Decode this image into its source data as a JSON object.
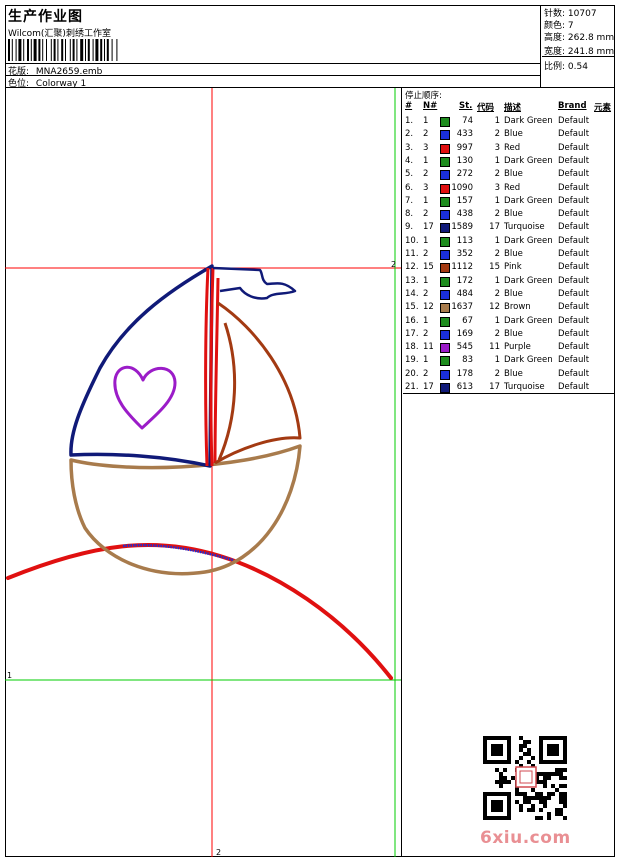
{
  "header": {
    "title": "生产作业图",
    "studio": "Wilcom(汇聚)刺绣工作室",
    "design_label": "花版:",
    "design_value": "MNA2659.emb",
    "colorway_label": "色位:",
    "colorway_value": "Colorway 1"
  },
  "stats": {
    "stitches_label": "针数:",
    "stitches_value": "10707",
    "colors_label": "颜色:",
    "colors_value": "7",
    "height_label": "高度:",
    "height_value": "262.8 mm",
    "width_label": "宽度:",
    "width_value": "241.8 mm",
    "scale_label": "比例:",
    "scale_value": "0.54"
  },
  "stop_panel": {
    "title": "停止顺序:",
    "headers": {
      "num": "#",
      "needle": "N#",
      "stitches": "St.",
      "code": "代码",
      "desc": "描述",
      "brand": "Brand",
      "element": "元素"
    },
    "rows": [
      {
        "num": "1.",
        "needle": "1",
        "st": "74",
        "code": "1",
        "desc": "Dark Green",
        "brand": "Default",
        "color": "#1e8c1e"
      },
      {
        "num": "2.",
        "needle": "2",
        "st": "433",
        "code": "2",
        "desc": "Blue",
        "brand": "Default",
        "color": "#1a2fd8"
      },
      {
        "num": "3.",
        "needle": "3",
        "st": "997",
        "code": "3",
        "desc": "Red",
        "brand": "Default",
        "color": "#e01010"
      },
      {
        "num": "4.",
        "needle": "1",
        "st": "130",
        "code": "1",
        "desc": "Dark Green",
        "brand": "Default",
        "color": "#1e8c1e"
      },
      {
        "num": "5.",
        "needle": "2",
        "st": "272",
        "code": "2",
        "desc": "Blue",
        "brand": "Default",
        "color": "#1a2fd8"
      },
      {
        "num": "6.",
        "needle": "3",
        "st": "1090",
        "code": "3",
        "desc": "Red",
        "brand": "Default",
        "color": "#e01010"
      },
      {
        "num": "7.",
        "needle": "1",
        "st": "157",
        "code": "1",
        "desc": "Dark Green",
        "brand": "Default",
        "color": "#1e8c1e"
      },
      {
        "num": "8.",
        "needle": "2",
        "st": "438",
        "code": "2",
        "desc": "Blue",
        "brand": "Default",
        "color": "#1a2fd8"
      },
      {
        "num": "9.",
        "needle": "17",
        "st": "1589",
        "code": "17",
        "desc": "Turquoise",
        "brand": "Default",
        "color": "#101a78"
      },
      {
        "num": "10.",
        "needle": "1",
        "st": "113",
        "code": "1",
        "desc": "Dark Green",
        "brand": "Default",
        "color": "#1e8c1e"
      },
      {
        "num": "11.",
        "needle": "2",
        "st": "352",
        "code": "2",
        "desc": "Blue",
        "brand": "Default",
        "color": "#1a2fd8"
      },
      {
        "num": "12.",
        "needle": "15",
        "st": "1112",
        "code": "15",
        "desc": "Pink",
        "brand": "Default",
        "color": "#a33a12"
      },
      {
        "num": "13.",
        "needle": "1",
        "st": "172",
        "code": "1",
        "desc": "Dark Green",
        "brand": "Default",
        "color": "#1e8c1e"
      },
      {
        "num": "14.",
        "needle": "2",
        "st": "484",
        "code": "2",
        "desc": "Blue",
        "brand": "Default",
        "color": "#1a2fd8"
      },
      {
        "num": "15.",
        "needle": "12",
        "st": "1637",
        "code": "12",
        "desc": "Brown",
        "brand": "Default",
        "color": "#a87b4c"
      },
      {
        "num": "16.",
        "needle": "1",
        "st": "67",
        "code": "1",
        "desc": "Dark Green",
        "brand": "Default",
        "color": "#1e8c1e"
      },
      {
        "num": "17.",
        "needle": "2",
        "st": "169",
        "code": "2",
        "desc": "Blue",
        "brand": "Default",
        "color": "#1a2fd8"
      },
      {
        "num": "18.",
        "needle": "11",
        "st": "545",
        "code": "11",
        "desc": "Purple",
        "brand": "Default",
        "color": "#9b1cc8"
      },
      {
        "num": "19.",
        "needle": "1",
        "st": "83",
        "code": "1",
        "desc": "Dark Green",
        "brand": "Default",
        "color": "#1e8c1e"
      },
      {
        "num": "20.",
        "needle": "2",
        "st": "178",
        "code": "2",
        "desc": "Blue",
        "brand": "Default",
        "color": "#1a2fd8"
      },
      {
        "num": "21.",
        "needle": "17",
        "st": "613",
        "code": "17",
        "desc": "Turquoise",
        "brand": "Default",
        "color": "#101a78"
      }
    ]
  },
  "canvas": {
    "marker_right": "2",
    "marker_left": "1",
    "marker_bottom": "2",
    "guide_red": "#ff0000",
    "guide_green": "#00cc00"
  },
  "watermark": "6xiu.com"
}
